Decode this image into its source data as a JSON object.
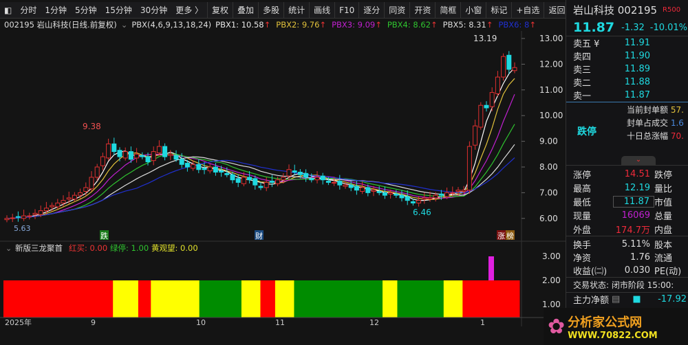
{
  "toolbar": {
    "items": [
      "分时",
      "1分钟",
      "5分钟",
      "15分钟",
      "30分钟",
      "更多 〉"
    ],
    "buttons": [
      "复权",
      "叠加",
      "多股",
      "统计",
      "画线",
      "F10",
      "逐分",
      "同资",
      "开资",
      "简框",
      "小窗",
      "标记",
      "+自选",
      "返回"
    ]
  },
  "info": {
    "code_name": "002195 岩山科技(日线.前复权)",
    "indicator": "PBX(4,6,9,13,18,24)",
    "pbx": [
      {
        "label": "PBX1: 10.58",
        "color": "#e8e8e8"
      },
      {
        "label": "PBX2: 9.76",
        "color": "#e2c23b"
      },
      {
        "label": "PBX3: 9.09",
        "color": "#c020d0"
      },
      {
        "label": "PBX4: 8.62",
        "color": "#2fc42f"
      },
      {
        "label": "PBX5: 8.31",
        "color": "#dddddd"
      },
      {
        "label": "PBX6: 8",
        "color": "#2030d0"
      }
    ],
    "arrow": "↑"
  },
  "chart_data": {
    "type": "candlestick",
    "yticks": [
      "13.00",
      "12.00",
      "11.00",
      "10.00",
      "9.00",
      "8.00",
      "7.00",
      "6.00"
    ],
    "ylim": [
      5.8,
      13.5
    ],
    "closes": [
      6.0,
      6.02,
      6.05,
      6.1,
      6.1,
      6.2,
      6.3,
      6.4,
      6.5,
      6.6,
      6.7,
      6.8,
      6.9,
      7.0,
      7.2,
      7.6,
      8.0,
      8.4,
      8.9,
      8.6,
      8.4,
      8.6,
      8.3,
      8.5,
      8.4,
      8.2,
      8.6,
      8.8,
      8.4,
      8.5,
      8.3,
      8.1,
      8.0,
      8.1,
      7.9,
      7.9,
      8.0,
      7.8,
      7.8,
      7.7,
      7.5,
      7.4,
      7.6,
      7.5,
      7.3,
      7.2,
      7.4,
      7.4,
      7.5,
      7.6,
      7.9,
      7.8,
      7.7,
      7.6,
      7.5,
      7.6,
      7.5,
      7.4,
      7.4,
      7.3,
      7.3,
      7.2,
      7.1,
      7.2,
      7.0,
      7.1,
      7.0,
      6.9,
      7.0,
      6.9,
      6.8,
      6.7,
      6.6,
      6.7,
      6.8,
      6.8,
      6.9,
      6.9,
      7.0,
      7.0,
      7.1,
      7.1,
      8.8,
      9.6,
      10.4,
      10.3,
      10.9,
      11.5,
      12.3,
      11.8,
      11.87
    ],
    "ma_periods": [
      4,
      6,
      9,
      13,
      18,
      24
    ],
    "ma_colors": [
      "#ffffff",
      "#e2c23b",
      "#c020d0",
      "#2fc42f",
      "#dddddd",
      "#2030d0"
    ],
    "annotations": {
      "high1": "9.38",
      "low1": "6.46",
      "start": "5.63",
      "high2": "13.19"
    },
    "markers": [
      "跌",
      "财",
      "涨",
      "榜"
    ],
    "x_labels": [
      "2025年",
      "9",
      "10",
      "11",
      "12",
      "1"
    ],
    "sub": {
      "title": "新版三龙聚首",
      "red_label": "红买: 0.00",
      "green_label": "绿停: 1.00",
      "yellow_label": "黄观望: 0.00",
      "yticks": [
        "3.00",
        "2.00",
        "1.00"
      ],
      "bands": [
        [
          "red",
          26
        ],
        [
          "yellow",
          6
        ],
        [
          "red",
          3
        ],
        [
          "yellow",
          11.5
        ],
        [
          "green",
          10
        ],
        [
          "yellow",
          4.5
        ],
        [
          "red",
          3.5
        ],
        [
          "yellow",
          4.5
        ],
        [
          "green",
          21
        ],
        [
          "yellow",
          3.5
        ],
        [
          "green",
          11
        ],
        [
          "yellow",
          4.5
        ],
        [
          "red",
          13.5
        ]
      ]
    }
  },
  "quote": {
    "name": "岩山科技 002195",
    "tag": "R500",
    "price": "11.87",
    "change": "-1.32",
    "pct": "-10.01%",
    "asks": [
      {
        "l": "卖五 ¥",
        "v": "11.91"
      },
      {
        "l": "卖四",
        "v": "11.90"
      },
      {
        "l": "卖三",
        "v": "11.89"
      },
      {
        "l": "卖二",
        "v": "11.88"
      },
      {
        "l": "卖一",
        "v": "11.87"
      }
    ],
    "status": "跌停",
    "seal_amount_label": "当前封单额",
    "seal_amount": "57.",
    "seal_ratio_label": "封单占成交",
    "seal_ratio": "1.6",
    "ten_day_label": "十日总涨幅",
    "ten_day": "70.",
    "stats": [
      [
        "涨停",
        "14.51",
        "跌停"
      ],
      [
        "最高",
        "12.19",
        "量比"
      ],
      [
        "最低",
        "11.87",
        "市值"
      ],
      [
        "现量",
        "16069",
        "总量"
      ],
      [
        "外盘",
        "174.7万",
        "内盘"
      ]
    ],
    "stats2": [
      [
        "换手",
        "5.11%",
        "股本"
      ],
      [
        "净资",
        "1.76",
        "流通"
      ],
      [
        "收益(㈡)",
        "0.030",
        "PE(动)"
      ]
    ],
    "trade_state": "交易状态: 闭市阶段 15:00:",
    "main_net_label": "主力净额",
    "main_net": "-17.92"
  },
  "logo": {
    "text": "分析家公式网",
    "url": "WWW.70822.COM"
  }
}
